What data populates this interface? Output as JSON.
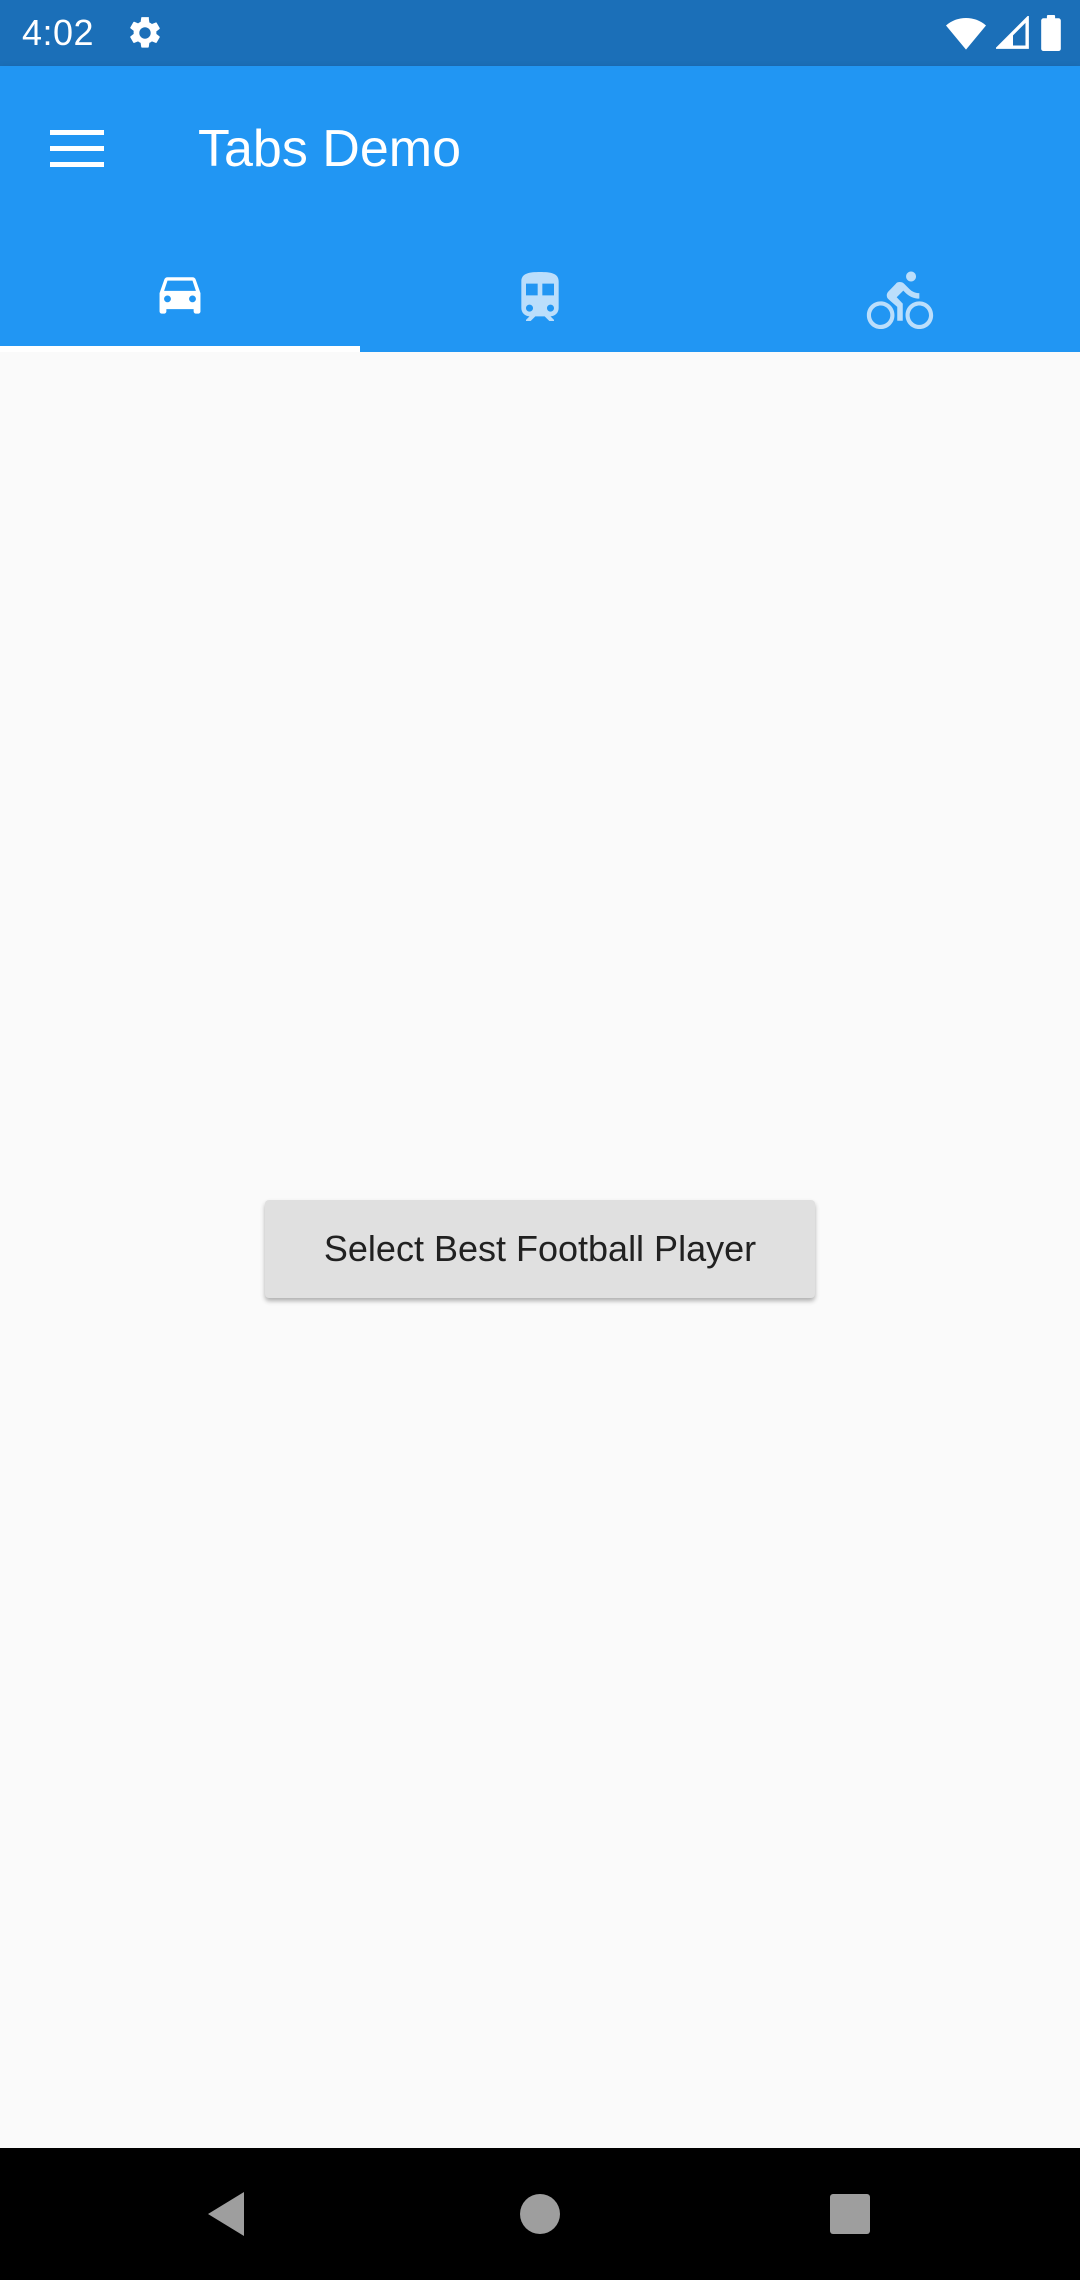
{
  "status_bar": {
    "time": "4:02",
    "icons": [
      "settings-icon",
      "wifi-icon",
      "cellular-signal-icon",
      "battery-icon"
    ]
  },
  "app_bar": {
    "title": "Tabs Demo",
    "menu_icon": "hamburger-menu-icon",
    "background_color": "#2196f3"
  },
  "tabs": [
    {
      "icon": "car-icon",
      "selected": true
    },
    {
      "icon": "train-icon",
      "selected": false
    },
    {
      "icon": "bicycle-icon",
      "selected": false
    }
  ],
  "main": {
    "button_label": "Select Best Football Player"
  },
  "nav_bar": {
    "icons": [
      "back-icon",
      "home-icon",
      "recents-icon"
    ]
  },
  "colors": {
    "status_bar": "#1b6fb8",
    "accent": "#2196f3",
    "background": "#fafafa",
    "button": "#e0e0e0"
  }
}
